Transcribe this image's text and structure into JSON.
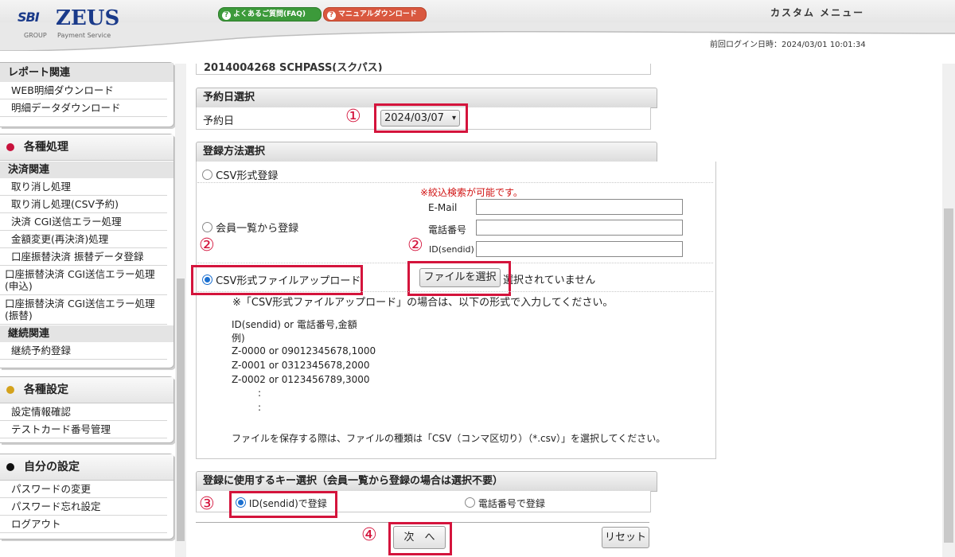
{
  "header": {
    "logo_sbi": "SBI",
    "logo_zeus": "ZEUS",
    "logo_group": "GROUP",
    "logo_sub": "Payment Service",
    "faq_label": "よくあるご質問(FAQ)",
    "manual_label": "マニュアルダウンロード",
    "custom_menu": "カスタム メニュー",
    "last_login": "前回ログイン日時：2024/03/01 10:01:34"
  },
  "sidebar": {
    "report": {
      "sub": "レポート関連",
      "items": [
        "WEB明細ダウンロード",
        "明細データダウンロード"
      ]
    },
    "processing": {
      "title": "各種処理",
      "dot_color": "#c8123c",
      "sub1": "決済関連",
      "items1": [
        "取り消し処理",
        "取り消し処理(CSV予約)",
        "決済 CGI送信エラー処理",
        "金額変更(再決済)処理",
        "口座振替決済 振替データ登録",
        "口座振替決済 CGI送信エラー処理(申込)",
        "口座振替決済 CGI送信エラー処理(振替)"
      ],
      "sub2": "継続関連",
      "items2": [
        "継続予約登録"
      ]
    },
    "settings": {
      "title": "各種設定",
      "dot_color": "#d4a21c",
      "items": [
        "設定情報確認",
        "テストカード番号管理"
      ]
    },
    "mine": {
      "title": "自分の設定",
      "dot_color": "#111111",
      "items": [
        "パスワードの変更",
        "パスワード忘れ設定",
        "ログアウト"
      ]
    }
  },
  "main": {
    "top_partial": "2014004268 SCHPASS(スクパス)",
    "date_section": {
      "title": "予約日選択",
      "label": "予約日",
      "selected": "2024/03/07"
    },
    "method_section": {
      "title": "登録方法選択",
      "opt_csv": "CSV形式登録",
      "opt_member": "会員一覧から登録",
      "opt_upload": "CSV形式ファイルアップロード",
      "search_note": "※絞込検索が可能です。",
      "email_label": "E-Mail",
      "phone_label": "電話番号",
      "id_label": "ID(sendid)",
      "email_value": "",
      "phone_value": "",
      "id_value": "",
      "file_button": "ファイルを選択",
      "file_status": "選択されていません",
      "instr": "※「CSV形式ファイルアップロード」の場合は、以下の形式で入力してください。",
      "format_lines": [
        "ID(sendid) or 電話番号,金額",
        "例)",
        "Z-0000 or 09012345678,1000",
        "Z-0001 or 0312345678,2000",
        "Z-0002 or 0123456789,3000",
        ":",
        ":"
      ],
      "save_note": "ファイルを保存する際は、ファイルの種類は「CSV（コンマ区切り）（*.csv）」を選択してください。"
    },
    "key_section": {
      "title": "登録に使用するキー選択（会員一覧から登録の場合は選択不要）",
      "opt_id": "ID(sendid)で登録",
      "opt_phone": "電話番号で登録"
    },
    "next_button": "次　へ",
    "reset_button": "リセット"
  },
  "callouts": [
    "①",
    "②",
    "②",
    "③",
    "④"
  ],
  "accent_color": "#d4143c"
}
